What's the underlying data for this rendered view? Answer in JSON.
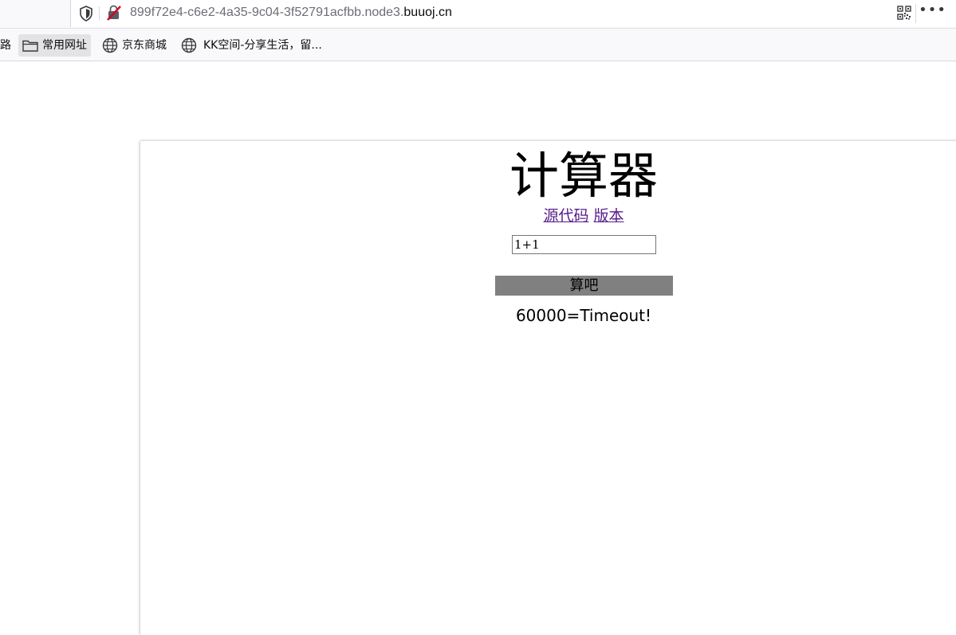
{
  "browser": {
    "url_dim": "899f72e4-c6e2-4a35-9c04-3f52791acfbb.node3.",
    "url_host": "buuoj.cn",
    "more_label": "•••"
  },
  "bookmarks": {
    "cut_label": "路",
    "items": [
      {
        "label": "常用网址",
        "icon": "folder-icon"
      },
      {
        "label": "京东商城",
        "icon": "globe-icon"
      },
      {
        "label": "KK空间-分享生活，留...",
        "icon": "globe-icon"
      }
    ]
  },
  "page": {
    "title": "计算器",
    "links": [
      "源代码",
      "版本"
    ],
    "input_value": "1+1",
    "button_label": "算吧",
    "result": "60000=Timeout!"
  },
  "colors": {
    "button_bg": "#808080",
    "link": "#551a8b",
    "insecure_icon": "#d70022"
  }
}
